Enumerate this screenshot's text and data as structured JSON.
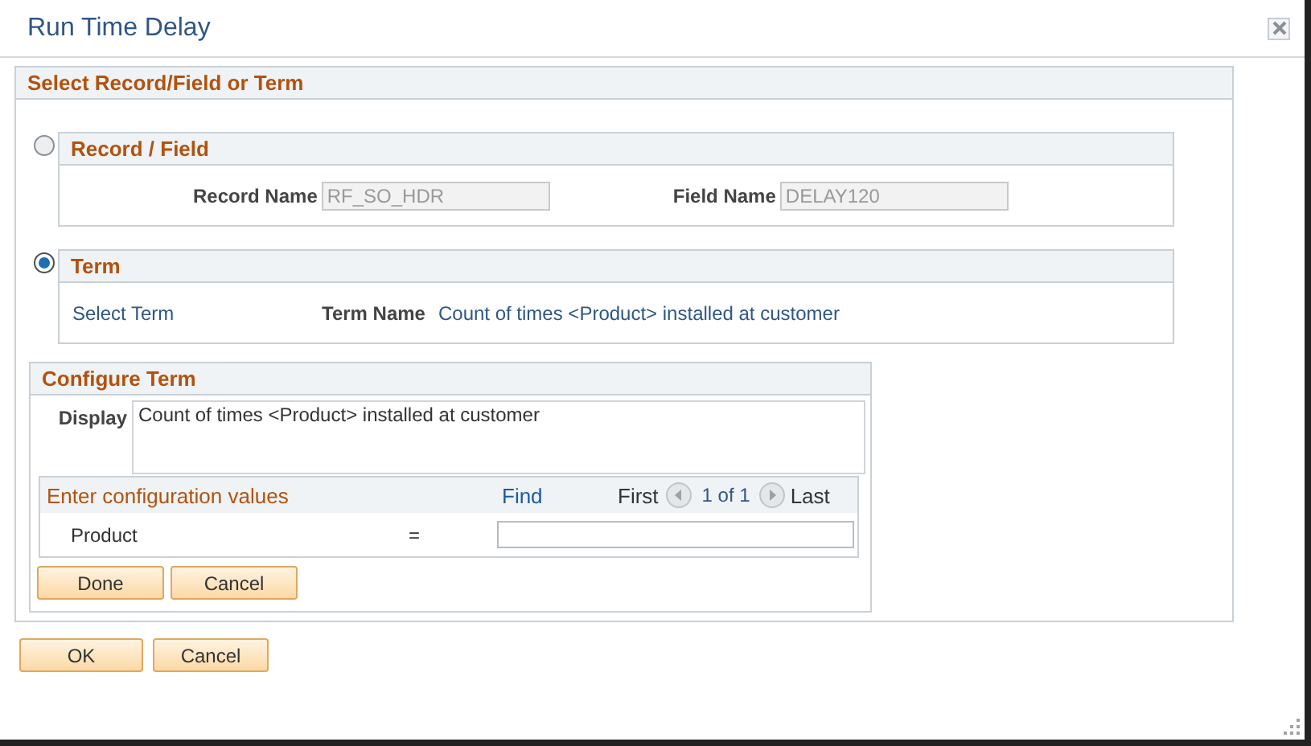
{
  "window": {
    "title": "Run Time Delay"
  },
  "section": {
    "title": "Select Record/Field or Term"
  },
  "sources": [
    {
      "kind": "record_field",
      "title": "Record / Field",
      "selected": false,
      "fields": [
        {
          "label": "Record Name",
          "value": "RF_SO_HDR",
          "disabled": true
        },
        {
          "label": "Field Name",
          "value": "DELAY120",
          "disabled": true
        }
      ]
    },
    {
      "kind": "term",
      "title": "Term",
      "selected": true,
      "link": "Select Term",
      "term_label": "Term Name",
      "term_value": "Count of times <Product> installed at customer"
    }
  ],
  "configure": {
    "title": "Configure Term",
    "display_label": "Display",
    "display_value": "Count of times <Product> installed at customer",
    "grid": {
      "title": "Enter configuration values",
      "find": "Find",
      "first": "First",
      "count": "1 of 1",
      "last": "Last",
      "rows": [
        {
          "name": "Product",
          "operator": "="
        }
      ]
    },
    "buttons": [
      "Done",
      "Cancel"
    ]
  },
  "buttons": [
    "OK",
    "Cancel"
  ]
}
